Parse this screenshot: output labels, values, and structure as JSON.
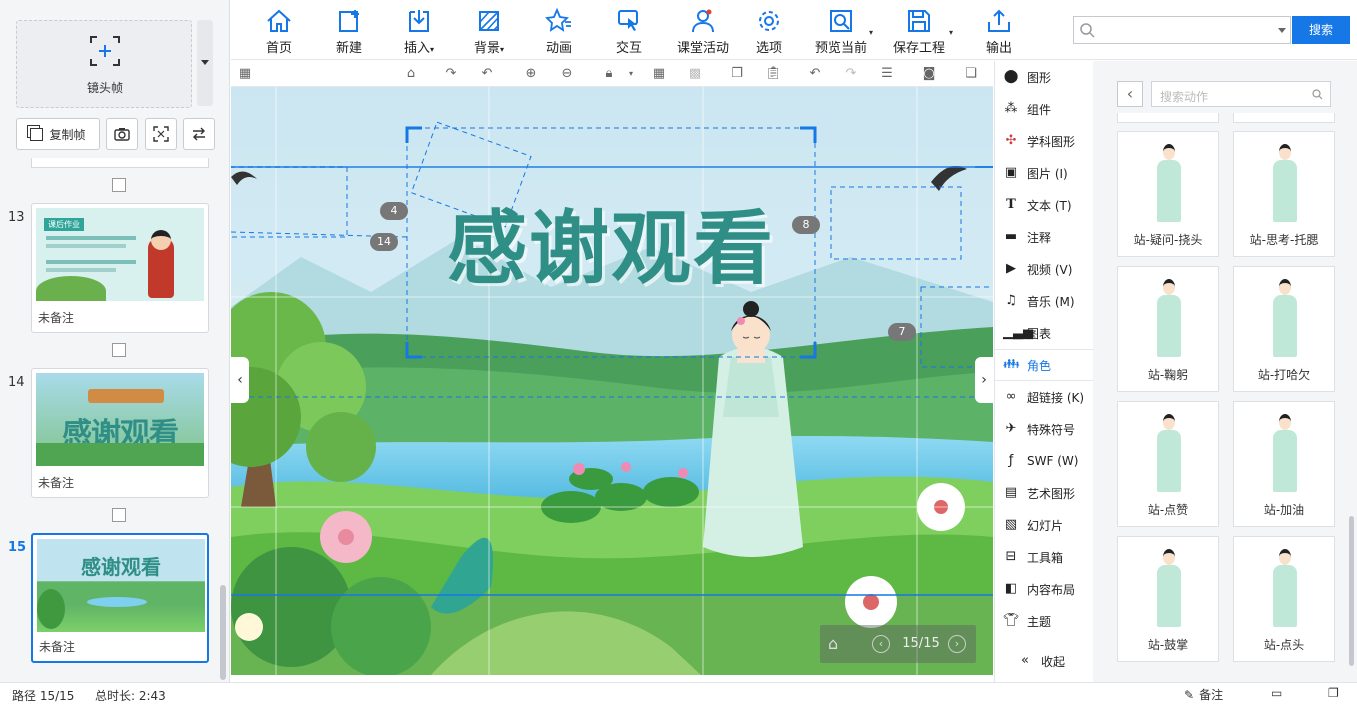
{
  "left_panel": {
    "frame_label": "镜头帧",
    "copy_frame": "复制帧",
    "slides": [
      {
        "number": "13",
        "note": "未备注",
        "thumb_title": "课后作业"
      },
      {
        "number": "14",
        "note": "未备注",
        "thumb_title": "感谢观看"
      },
      {
        "number": "15",
        "note": "未备注",
        "thumb_title": "感谢观看"
      }
    ]
  },
  "toolbar": {
    "items": [
      {
        "label": "首页",
        "icon": "home-icon"
      },
      {
        "label": "新建",
        "icon": "new-icon"
      },
      {
        "label": "插入",
        "icon": "insert-icon"
      },
      {
        "label": "背景",
        "icon": "background-icon"
      },
      {
        "label": "动画",
        "icon": "animation-icon"
      },
      {
        "label": "交互",
        "icon": "interaction-icon"
      },
      {
        "label": "课堂活动",
        "icon": "class-activity-icon"
      },
      {
        "label": "选项",
        "icon": "options-icon"
      },
      {
        "label": "预览当前",
        "icon": "preview-icon"
      },
      {
        "label": "保存工程",
        "icon": "save-icon"
      },
      {
        "label": "输出",
        "icon": "export-icon"
      }
    ],
    "search_button": "搜索",
    "search_value": ""
  },
  "canvas": {
    "title": "感谢观看",
    "badges": [
      "4",
      "14",
      "8",
      "7"
    ],
    "page_indicator": "15/15"
  },
  "components": {
    "items": [
      {
        "label": "图形",
        "icon": "shape-icon"
      },
      {
        "label": "组件",
        "icon": "component-icon"
      },
      {
        "label": "学科图形",
        "icon": "subject-shape-icon"
      },
      {
        "label": "图片 (I)",
        "icon": "image-icon"
      },
      {
        "label": "文本 (T)",
        "icon": "text-icon"
      },
      {
        "label": "注释",
        "icon": "comment-icon"
      },
      {
        "label": "视频 (V)",
        "icon": "video-icon"
      },
      {
        "label": "音乐 (M)",
        "icon": "music-icon"
      },
      {
        "label": "图表",
        "icon": "chart-icon"
      },
      {
        "label": "角色",
        "icon": "character-icon"
      },
      {
        "label": "超链接 (K)",
        "icon": "link-icon"
      },
      {
        "label": "特殊符号",
        "icon": "plane-icon"
      },
      {
        "label": "SWF (W)",
        "icon": "swf-icon"
      },
      {
        "label": "艺术图形",
        "icon": "art-shape-icon"
      },
      {
        "label": "幻灯片",
        "icon": "slideshow-icon"
      },
      {
        "label": "工具箱",
        "icon": "toolbox-icon"
      },
      {
        "label": "内容布局",
        "icon": "layout-icon"
      },
      {
        "label": "主题",
        "icon": "theme-icon"
      }
    ],
    "collapse": "收起",
    "active_index": 9
  },
  "characters": {
    "search_placeholder": "搜索动作",
    "items": [
      "站-疑问-挠头",
      "站-思考-托腮",
      "站-鞠躬",
      "站-打哈欠",
      "站-点赞",
      "站-加油",
      "站-鼓掌",
      "站-点头"
    ]
  },
  "status": {
    "path": "路径 15/15",
    "duration": "总时长: 2:43",
    "note": "备注"
  },
  "colors": {
    "accent": "#1677e6",
    "title_teal": "#2f8f86"
  }
}
